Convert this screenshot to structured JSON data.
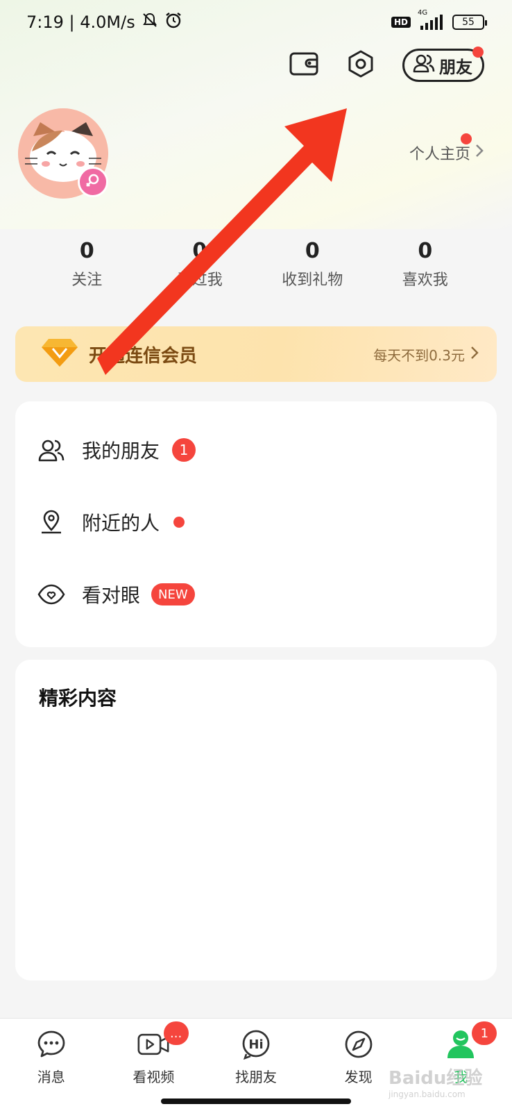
{
  "status_bar": {
    "time_speed": "7:19 | 4.0M/s",
    "hd": "HD",
    "network": "4G",
    "battery": "55"
  },
  "top": {
    "friends_label": "朋友"
  },
  "profile": {
    "home_link": "个人主页"
  },
  "stats": [
    {
      "value": "0",
      "label": "关注"
    },
    {
      "value": "0",
      "label": "看过我"
    },
    {
      "value": "0",
      "label": "收到礼物"
    },
    {
      "value": "0",
      "label": "喜欢我"
    }
  ],
  "vip": {
    "title": "开通连信会员",
    "subtitle": "每天不到0.3元"
  },
  "menu": [
    {
      "label": "我的朋友",
      "badge": "1"
    },
    {
      "label": "附近的人"
    },
    {
      "label": "看对眼",
      "badge": "NEW"
    }
  ],
  "content": {
    "title": "精彩内容"
  },
  "nav": [
    {
      "label": "消息"
    },
    {
      "label": "看视频",
      "badge": "..."
    },
    {
      "label": "找朋友"
    },
    {
      "label": "发现"
    },
    {
      "label": "我",
      "badge": "1"
    }
  ],
  "watermark": {
    "text": "Baidu经验",
    "sub": "jingyan.baidu.com"
  },
  "colors": {
    "accent_red": "#f5453d",
    "brand_green": "#22c55e",
    "vip_gold": "#fde6b2",
    "arrow_red": "#f2361f"
  }
}
